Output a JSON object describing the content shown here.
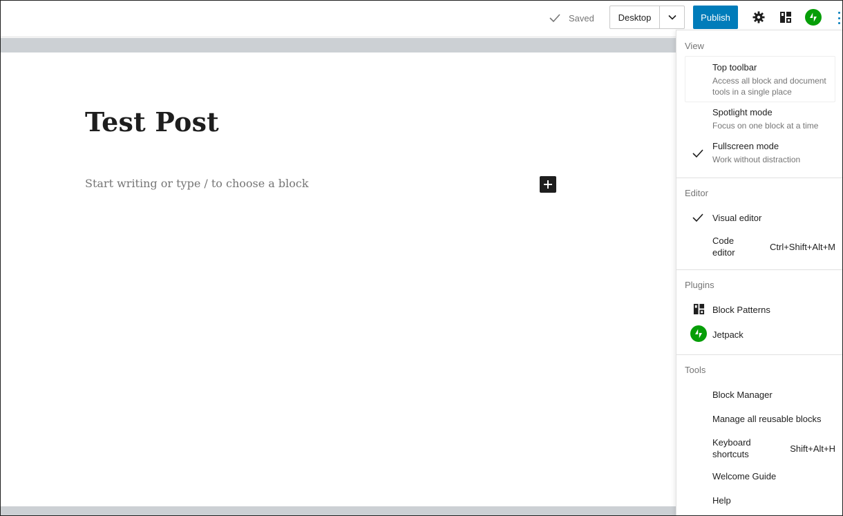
{
  "topbar": {
    "saved_label": "Saved",
    "preview_label": "Desktop",
    "publish_label": "Publish"
  },
  "colors": {
    "accent": "#007cba",
    "jetpack": "#069e08",
    "strip": "#ccd0d4"
  },
  "editor": {
    "title": "Test Post",
    "placeholder": "Start writing or type / to choose a block"
  },
  "menu": {
    "view": {
      "label": "View",
      "items": [
        {
          "title": "Top toolbar",
          "desc": "Access all block and document tools in a single place",
          "checked": false
        },
        {
          "title": "Spotlight mode",
          "desc": "Focus on one block at a time",
          "checked": false
        },
        {
          "title": "Fullscreen mode",
          "desc": "Work without distraction",
          "checked": true
        }
      ]
    },
    "editor": {
      "label": "Editor",
      "items": [
        {
          "title": "Visual editor",
          "shortcut": "",
          "checked": true
        },
        {
          "title": "Code editor",
          "shortcut": "Ctrl+Shift+Alt+M",
          "checked": false
        }
      ]
    },
    "plugins": {
      "label": "Plugins",
      "items": [
        {
          "title": "Block Patterns",
          "icon": "block-patterns-icon"
        },
        {
          "title": "Jetpack",
          "icon": "jetpack-icon"
        }
      ]
    },
    "tools": {
      "label": "Tools",
      "items": [
        {
          "title": "Block Manager",
          "shortcut": ""
        },
        {
          "title": "Manage all reusable blocks",
          "shortcut": ""
        },
        {
          "title": "Keyboard shortcuts",
          "shortcut": "Shift+Alt+H"
        },
        {
          "title": "Welcome Guide",
          "shortcut": ""
        },
        {
          "title": "Help",
          "shortcut": ""
        }
      ]
    }
  }
}
